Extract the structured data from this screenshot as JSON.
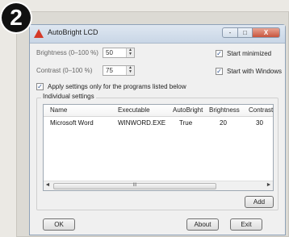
{
  "step_number": "2",
  "window": {
    "title": "AutoBright LCD",
    "controls": {
      "minimize": "-",
      "maximize": "□",
      "close": "X"
    }
  },
  "settings": {
    "brightness_label": "Brightness (0–100 %)",
    "brightness_value": "50",
    "contrast_label": "Contrast (0–100 %)",
    "contrast_value": "75",
    "start_minimized_label": "Start minimized",
    "start_minimized_checked": true,
    "start_with_windows_label": "Start with Windows",
    "start_with_windows_checked": true,
    "apply_only_label": "Apply settings only for the programs listed below",
    "apply_only_checked": true
  },
  "group": {
    "title": "Individual settings"
  },
  "table": {
    "columns": [
      "Name",
      "Executable",
      "AutoBright",
      "Brightness",
      "Contrast"
    ],
    "rows": [
      [
        "Microsoft Word",
        "WINWORD.EXE",
        "True",
        "20",
        "30"
      ]
    ]
  },
  "buttons": {
    "add": "Add",
    "ok": "OK",
    "about": "About",
    "exit": "Exit"
  },
  "scroll_arrows": {
    "left": "◄",
    "right": "►",
    "grip": "III"
  },
  "spin_arrows": {
    "up": "▲",
    "down": "▼"
  },
  "check_mark": "✓"
}
